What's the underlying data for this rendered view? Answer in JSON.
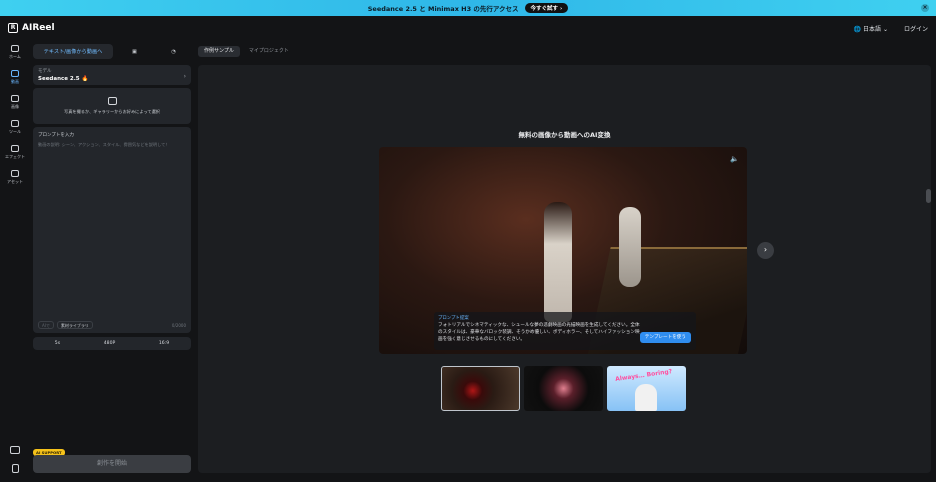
{
  "banner": {
    "text": "Seedance 2.5 と Minimax H3 の先行アクセス",
    "cta": "今すぐ試す ›",
    "close": "×"
  },
  "brand": {
    "logo_letter": "R",
    "name": "AIReel"
  },
  "topbar": {
    "language": "🌐 日本語 ⌄",
    "login": "ログイン"
  },
  "rail": [
    {
      "label": "ホーム",
      "icon": "home-icon"
    },
    {
      "label": "動画",
      "icon": "video-icon"
    },
    {
      "label": "画像",
      "icon": "image-icon"
    },
    {
      "label": "ツール",
      "icon": "tool-icon"
    },
    {
      "label": "エフェクト",
      "icon": "effect-icon"
    },
    {
      "label": "アセット",
      "icon": "folder-icon"
    }
  ],
  "panel": {
    "mode_tabs": {
      "active": "テキスト/画像から動画へ",
      "tab2_icon": "image-to-video-icon",
      "tab3_icon": "avatar-icon"
    },
    "model": {
      "label": "モデル",
      "value": "Seedance 2.5 🔥",
      "chevron": "›"
    },
    "upload": {
      "text": "写真を撮るか、ギャラリーからお好みによって選択"
    },
    "prompt": {
      "label": "プロンプトを入力",
      "placeholder": "動画の説明: シーン、アクション、スタイル、雰囲気などを説明して！",
      "chip_ai": "AIで",
      "chip_library": "素材ライブラリ",
      "count": "0/2000"
    },
    "settings": {
      "duration": "5s",
      "resolution": "480P",
      "ratio": "16:9"
    },
    "badge": "AI SUPPORT",
    "generate": "創作を開始"
  },
  "tabs": {
    "samples": "作例サンプル",
    "projects": "マイプロジェクト"
  },
  "main": {
    "headline": "無料の画像から動画へのAI変換",
    "caption": {
      "title": "プロンプト提案",
      "text": "フォトリアルでシネマティックな、シュールな夢の悲劇映画の光描映画を生成してください。全体のスタイルは、豪華なバロック装調、そうかめ優しい、ボディホラー、そしてハイファッション映画を強く意じさせるものにしてください。",
      "button": "テンプレートを使う"
    },
    "thumb3_word": "Always… Boring?",
    "next": "›"
  }
}
